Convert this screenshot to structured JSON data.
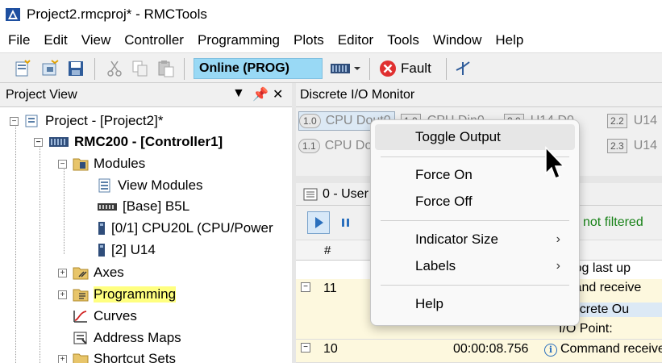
{
  "window": {
    "title": "Project2.rmcproj* - RMCTools",
    "brand_color": "#1e4fa0"
  },
  "menubar": {
    "items": [
      "File",
      "Edit",
      "View",
      "Controller",
      "Programming",
      "Plots",
      "Editor",
      "Tools",
      "Window",
      "Help"
    ]
  },
  "toolbar": {
    "icons": [
      "new-project-icon",
      "open-project-icon",
      "save-icon",
      "cut-icon",
      "copy-icon",
      "paste-icon"
    ],
    "mode": "Online (PROG)",
    "fault_label": "Fault"
  },
  "project_view": {
    "title": "Project View",
    "tree": {
      "project": "Project - [Project2]*",
      "controller": "RMC200 - [Controller1]",
      "modules": "Modules",
      "view_modules": "View Modules",
      "base": "[Base] B5L",
      "cpu": "[0/1] CPU20L (CPU/Power",
      "u14": "[2] U14",
      "axes": "Axes",
      "programming": "Programming",
      "curves": "Curves",
      "address_maps": "Address Maps",
      "shortcut_sets": "Shortcut Sets"
    }
  },
  "dio_monitor": {
    "title": "Discrete I/O Monitor",
    "indicators": [
      {
        "badge": "1.0",
        "label": "CPU Dout0"
      },
      {
        "badge": "1.1",
        "label": "CPU Do"
      },
      {
        "badge": "1.0",
        "label": "CPU Din0"
      },
      {
        "badge": "2.0",
        "label": "U14 D0"
      },
      {
        "badge": "2.2",
        "label": "U14"
      },
      {
        "badge": "2.3",
        "label": "U14"
      }
    ]
  },
  "event_log": {
    "title": "0 - User",
    "filter_status": "not filtered",
    "column_num": "#",
    "rows": [
      {
        "num": "11",
        "time": "",
        "lines": [
          "ent Log last up",
          "ommand receive",
          "ar Discrete Ou",
          "I/O Point:"
        ]
      },
      {
        "num": "10",
        "time": "00:00:08.756",
        "lines": [
          "Command receive"
        ]
      }
    ]
  },
  "context_menu": {
    "items": [
      {
        "label": "Toggle Output",
        "submenu": false
      },
      {
        "label": "Force On",
        "submenu": false
      },
      {
        "label": "Force Off",
        "submenu": false
      },
      {
        "label": "Indicator Size",
        "submenu": true
      },
      {
        "label": "Labels",
        "submenu": true
      },
      {
        "label": "Help",
        "submenu": false
      }
    ],
    "highlighted_index": 0
  }
}
